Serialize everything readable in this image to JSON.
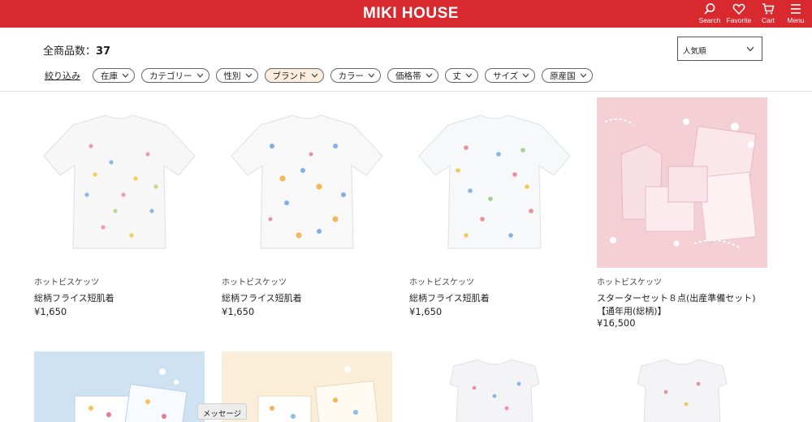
{
  "header": {
    "logo": "MIKI HOUSE",
    "search_label": "Search",
    "favorite_label": "Favorite",
    "cart_label": "Cart",
    "menu_label": "Menu",
    "brand_color": "#d8292f"
  },
  "toolbar": {
    "count_label": "全商品数：",
    "count_value": "37",
    "sort_selected": "人気順",
    "reset_label": "絞り込み",
    "filters": [
      "在庫",
      "カテゴリー",
      "性別",
      "ブランド",
      "カラー",
      "価格帯",
      "丈",
      "サイズ",
      "原産国"
    ]
  },
  "products": [
    {
      "brand": "ホットビスケッツ",
      "name": "総柄フライス短肌着",
      "price": "¥1,650"
    },
    {
      "brand": "ホットビスケッツ",
      "name": "総柄フライス短肌着",
      "price": "¥1,650"
    },
    {
      "brand": "ホットビスケッツ",
      "name": "総柄フライス短肌着",
      "price": "¥1,650"
    },
    {
      "brand": "ホットビスケッツ",
      "name_line1": "スターターセット８点(出産準備セット)",
      "name_line2": "【通年用(総柄)】",
      "price": "¥16,500"
    }
  ],
  "message_tab": "メッセージ",
  "icons": [
    "search-icon",
    "heart-icon",
    "cart-icon",
    "menu-icon",
    "chevron-down-icon"
  ]
}
